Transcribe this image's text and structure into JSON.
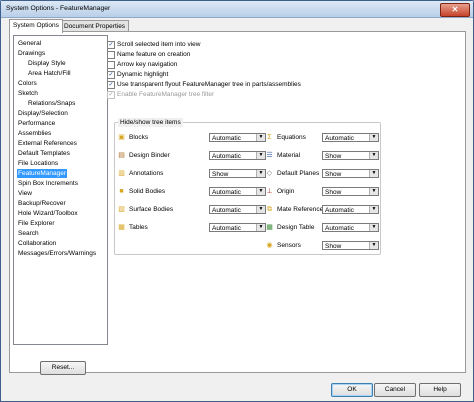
{
  "window": {
    "title": "System Options - FeatureManager",
    "close_symbol": "✕"
  },
  "tabs": [
    {
      "label": "System Options"
    },
    {
      "label": "Document Properties"
    }
  ],
  "tree": {
    "items": [
      {
        "label": "General",
        "level": 0
      },
      {
        "label": "Drawings",
        "level": 0
      },
      {
        "label": "Display Style",
        "level": 1
      },
      {
        "label": "Area Hatch/Fill",
        "level": 1
      },
      {
        "label": "Colors",
        "level": 0
      },
      {
        "label": "Sketch",
        "level": 0
      },
      {
        "label": "Relations/Snaps",
        "level": 1
      },
      {
        "label": "Display/Selection",
        "level": 0
      },
      {
        "label": "Performance",
        "level": 0
      },
      {
        "label": "Assemblies",
        "level": 0
      },
      {
        "label": "External References",
        "level": 0
      },
      {
        "label": "Default Templates",
        "level": 0
      },
      {
        "label": "File Locations",
        "level": 0
      },
      {
        "label": "FeatureManager",
        "level": 0,
        "selected": true
      },
      {
        "label": "Spin Box Increments",
        "level": 0
      },
      {
        "label": "View",
        "level": 0
      },
      {
        "label": "Backup/Recover",
        "level": 0
      },
      {
        "label": "Hole Wizard/Toolbox",
        "level": 0
      },
      {
        "label": "File Explorer",
        "level": 0
      },
      {
        "label": "Search",
        "level": 0
      },
      {
        "label": "Collaboration",
        "level": 0
      },
      {
        "label": "Messages/Errors/Warnings",
        "level": 0
      }
    ],
    "reset_label": "Reset..."
  },
  "options": [
    {
      "label": "Scroll selected item into view",
      "checked": true
    },
    {
      "label": "Name feature on creation",
      "checked": false
    },
    {
      "label": "Arrow key navigation",
      "checked": false
    },
    {
      "label": "Dynamic highlight",
      "checked": true
    },
    {
      "label": "Use transparent flyout FeatureManager tree in parts/assemblies",
      "checked": true
    },
    {
      "label": "Enable FeatureManager tree filter",
      "checked": true,
      "disabled": true
    }
  ],
  "hide_show": {
    "title": "Hide/show tree items",
    "left": [
      {
        "label": "Blocks",
        "value": "Automatic",
        "icon": "blocks-icon"
      },
      {
        "label": "Design Binder",
        "value": "Automatic",
        "icon": "design-binder-icon"
      },
      {
        "label": "Annotations",
        "value": "Show",
        "icon": "annotations-icon"
      },
      {
        "label": "Solid Bodies",
        "value": "Automatic",
        "icon": "solid-bodies-icon"
      },
      {
        "label": "Surface Bodies",
        "value": "Automatic",
        "icon": "surface-bodies-icon"
      },
      {
        "label": "Tables",
        "value": "Automatic",
        "icon": "tables-icon"
      }
    ],
    "right": [
      {
        "label": "Equations",
        "value": "Automatic",
        "icon": "equations-icon"
      },
      {
        "label": "Material",
        "value": "Show",
        "icon": "material-icon"
      },
      {
        "label": "Default Planes",
        "value": "Show",
        "icon": "default-planes-icon"
      },
      {
        "label": "Origin",
        "value": "Show",
        "icon": "origin-icon"
      },
      {
        "label": "Mate References",
        "value": "Automatic",
        "icon": "mate-references-icon"
      },
      {
        "label": "Design Table",
        "value": "Automatic",
        "icon": "design-table-icon"
      },
      {
        "label": "Sensors",
        "value": "Show",
        "icon": "sensors-icon"
      }
    ]
  },
  "buttons": {
    "ok": "OK",
    "cancel": "Cancel",
    "help": "Help"
  },
  "colors": {
    "selection": "#3399ff",
    "title_bar": "#c9dbef",
    "accent_icon": "#d9a520"
  }
}
